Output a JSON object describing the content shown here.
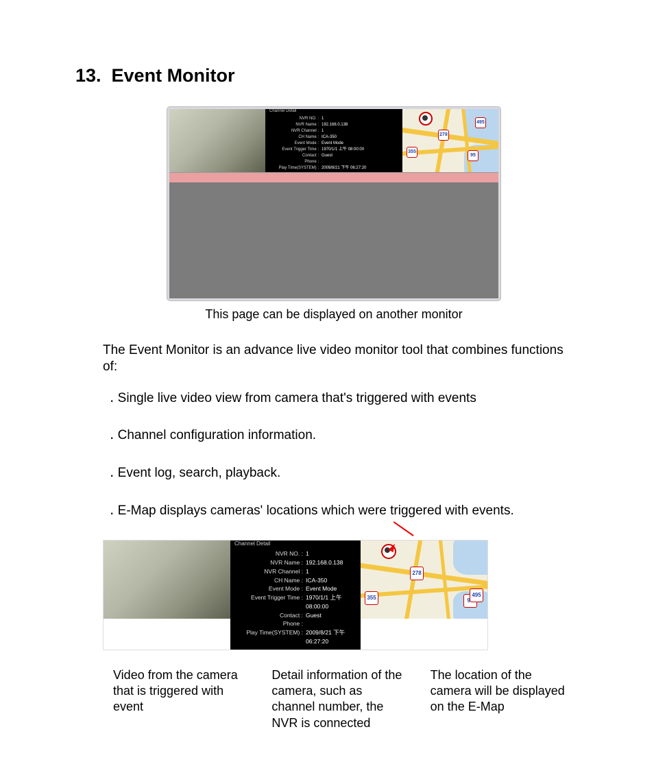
{
  "heading": "13.  Event Monitor",
  "caption": "This page can be displayed on another monitor",
  "intro": "The Event Monitor is an advance live video monitor tool that combines functions of:",
  "bullets": [
    "Single live video view from camera that's triggered with events",
    "Channel configuration information.",
    "Event log, search, playback.",
    "E-Map displays cameras' locations which were triggered with events."
  ],
  "channel_detail": {
    "legend": "Channel Detail",
    "rows": [
      {
        "label": "NVR NO. :",
        "value": "1"
      },
      {
        "label": "NVR Name :",
        "value": "192.168.0.138"
      },
      {
        "label": "NVR Channel :",
        "value": "1"
      },
      {
        "label": "CH Name :",
        "value": "ICA-350"
      },
      {
        "label": "Event Mode :",
        "value": "Event Mode"
      },
      {
        "label": "Event Trigger Time :",
        "value": "1970/1/1 上午 08:00:00"
      },
      {
        "label": "Contact :",
        "value": "Guest"
      },
      {
        "label": "Phone :",
        "value": ""
      },
      {
        "label": "Play Time(SYSTEM) :",
        "value": "2009/8/21 下午 06:27:20"
      }
    ]
  },
  "map": {
    "shields": [
      "355",
      "278",
      "95",
      "495"
    ]
  },
  "columns": {
    "left": "Video from the camera that is triggered with event",
    "middle": "Detail information of the camera, such as channel number, the NVR is connected",
    "right": "The location of the camera will be displayed on the E-Map"
  }
}
